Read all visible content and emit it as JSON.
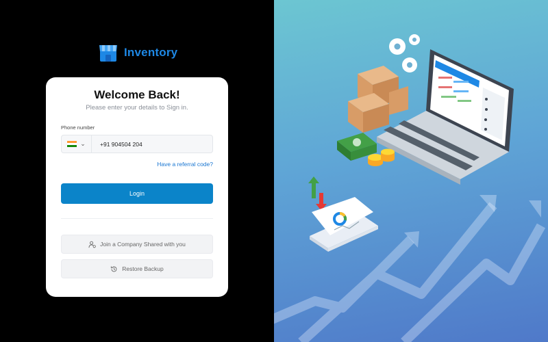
{
  "brand": {
    "name": "Inventory",
    "icon": "store-icon",
    "color": "#1e88e5"
  },
  "card": {
    "title": "Welcome Back!",
    "subtitle": "Please enter your details to Sign in."
  },
  "phone": {
    "label": "Phone number",
    "country_flag": "india-flag-icon",
    "value": "+91 904504 204"
  },
  "referral_link": "Have a referral code?",
  "login_label": "Login",
  "join_label": "Join a Company Shared with you",
  "restore_label": "Restore Backup",
  "colors": {
    "primary": "#0b84c9",
    "panel_gradient_top": "#6cc6d2",
    "panel_gradient_bottom": "#4f79c9"
  }
}
